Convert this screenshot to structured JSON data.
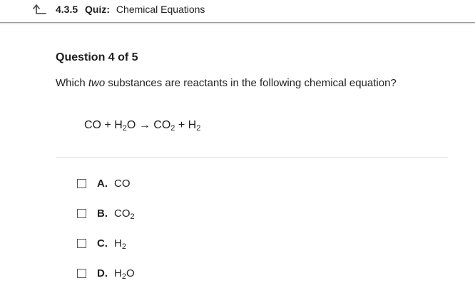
{
  "header": {
    "number": "4.3.5",
    "type": "Quiz:",
    "title": "Chemical Equations",
    "back_icon": "arrow-up-left-icon"
  },
  "question": {
    "heading": "Question 4 of 5",
    "prompt_before": "Which ",
    "prompt_emphasis": "two",
    "prompt_after": " substances are reactants in the following chemical equation?",
    "equation": {
      "p1": "CO + H",
      "s1": "2",
      "p2": "O",
      "arrow": " → ",
      "p3": "CO",
      "s2": "2",
      "p4": " + H",
      "s3": "2"
    }
  },
  "answers": [
    {
      "letter": "A.",
      "main": "CO",
      "sub": "",
      "tail": "",
      "checked": false
    },
    {
      "letter": "B.",
      "main": "CO",
      "sub": "2",
      "tail": "",
      "checked": false
    },
    {
      "letter": "C.",
      "main": "H",
      "sub": "2",
      "tail": "",
      "checked": false
    },
    {
      "letter": "D.",
      "main": "H",
      "sub": "2",
      "tail": "O",
      "checked": false
    }
  ]
}
